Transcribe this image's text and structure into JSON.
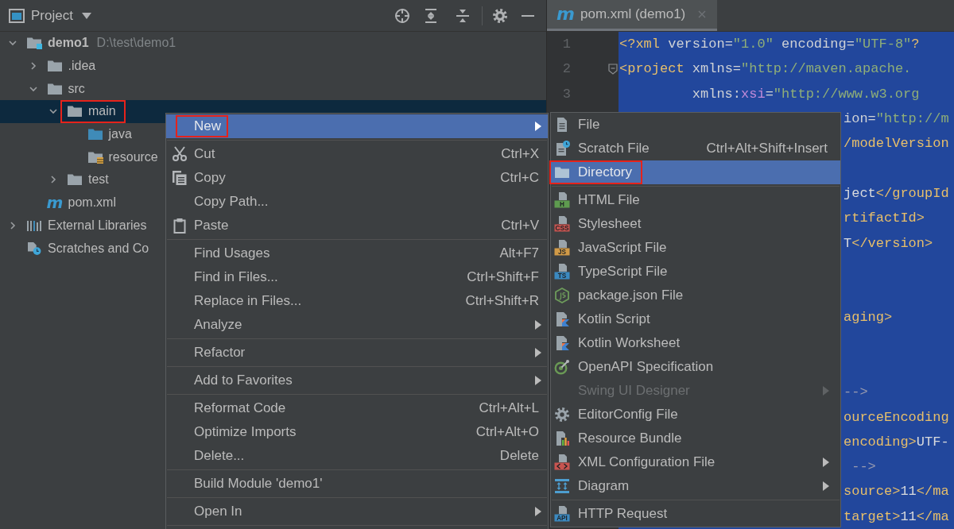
{
  "tool_window": {
    "title": "Project"
  },
  "project_tree": [
    {
      "label": "demo1",
      "path": "D:\\test\\demo1",
      "kind": "module",
      "expanded": true,
      "selected": false,
      "annotated": false,
      "children": [
        {
          "label": ".idea",
          "kind": "folder",
          "expanded": false,
          "selected": false,
          "annotated": false
        },
        {
          "label": "src",
          "kind": "folder",
          "expanded": true,
          "selected": false,
          "annotated": false,
          "children": [
            {
              "label": "main",
              "kind": "folder",
              "expanded": true,
              "selected": true,
              "annotated": true,
              "children": [
                {
                  "label": "java",
                  "kind": "source_folder",
                  "selected": false,
                  "annotated": false
                },
                {
                  "label": "resource",
                  "kind": "resources_folder",
                  "selected": false,
                  "annotated": false
                }
              ]
            },
            {
              "label": "test",
              "kind": "folder",
              "expanded": false,
              "selected": false,
              "annotated": false
            }
          ]
        },
        {
          "label": "pom.xml",
          "kind": "maven_file",
          "icon_glyph": "m",
          "selected": false,
          "annotated": false
        }
      ]
    },
    {
      "label": "External Libraries",
      "kind": "libraries",
      "expanded": false,
      "selected": false,
      "annotated": false
    },
    {
      "label": "Scratches and Co",
      "kind": "scratches",
      "selected": false,
      "annotated": false
    }
  ],
  "editor": {
    "tabs": [
      {
        "label": "pom.xml (demo1)",
        "icon_glyph": "m",
        "selected": true
      }
    ],
    "lines": [
      {
        "kind": "full",
        "number": "1",
        "fold_marker": false,
        "segments": [
          {
            "text": "<?xml",
            "kind": "tag"
          },
          {
            "text": " version",
            "kind": "attr"
          },
          {
            "text": "=",
            "kind": "attr"
          },
          {
            "text": "\"1.0\"",
            "kind": "value"
          },
          {
            "text": " encoding",
            "kind": "attr"
          },
          {
            "text": "=",
            "kind": "attr"
          },
          {
            "text": "\"UTF-8\"",
            "kind": "value"
          },
          {
            "text": "?",
            "kind": "tag"
          }
        ]
      },
      {
        "kind": "full",
        "number": "2",
        "fold_marker": true,
        "segments": [
          {
            "text": "<project",
            "kind": "tag"
          },
          {
            "text": " xmlns",
            "kind": "attr"
          },
          {
            "text": "=",
            "kind": "attr"
          },
          {
            "text": "\"http://maven.apache.",
            "kind": "value"
          }
        ]
      },
      {
        "kind": "full",
        "number": "3",
        "fold_marker": false,
        "segments": [
          {
            "text": "         xmlns:",
            "kind": "attr"
          },
          {
            "text": "xsi",
            "kind": "ns"
          },
          {
            "text": "=",
            "kind": "attr"
          },
          {
            "text": "\"http://www.w3.org",
            "kind": "value"
          }
        ]
      },
      {
        "kind": "tail",
        "segments": [
          {
            "text": "ion",
            "kind": "attr"
          },
          {
            "text": "=",
            "kind": "attr"
          },
          {
            "text": "\"http://m",
            "kind": "value"
          }
        ]
      },
      {
        "kind": "tail",
        "segments": [
          {
            "text": "/modelVersion",
            "kind": "tag"
          }
        ]
      },
      {
        "kind": "blank"
      },
      {
        "kind": "tail",
        "segments": [
          {
            "text": "ject",
            "kind": "text"
          },
          {
            "text": "</groupId",
            "kind": "tag"
          }
        ]
      },
      {
        "kind": "tail",
        "segments": [
          {
            "text": "rtifactId>",
            "kind": "tag"
          }
        ]
      },
      {
        "kind": "tail",
        "segments": [
          {
            "text": "T",
            "kind": "text"
          },
          {
            "text": "</version>",
            "kind": "tag"
          }
        ]
      },
      {
        "kind": "blank"
      },
      {
        "kind": "blank"
      },
      {
        "kind": "tail",
        "segments": [
          {
            "text": "aging>",
            "kind": "tag"
          }
        ]
      },
      {
        "kind": "blank"
      },
      {
        "kind": "blank"
      },
      {
        "kind": "tail",
        "segments": [
          {
            "text": "-->",
            "kind": "comment"
          }
        ]
      },
      {
        "kind": "tail",
        "segments": [
          {
            "text": "ourceEncoding",
            "kind": "tag"
          }
        ]
      },
      {
        "kind": "tail",
        "segments": [
          {
            "text": "encoding>",
            "kind": "tag"
          },
          {
            "text": "UTF-",
            "kind": "text"
          }
        ]
      },
      {
        "kind": "tail",
        "segments": [
          {
            "text": " -->",
            "kind": "comment"
          }
        ]
      },
      {
        "kind": "tail",
        "segments": [
          {
            "text": "source>",
            "kind": "tag"
          },
          {
            "text": "11",
            "kind": "text"
          },
          {
            "text": "</ma",
            "kind": "tag"
          }
        ]
      },
      {
        "kind": "tail",
        "segments": [
          {
            "text": "target>",
            "kind": "tag"
          },
          {
            "text": "11",
            "kind": "text"
          },
          {
            "text": "</ma",
            "kind": "tag"
          }
        ]
      }
    ]
  },
  "context_menu": {
    "items": [
      {
        "kind": "plain",
        "label": "New",
        "has_submenu": true,
        "selected": true,
        "annotated": true
      },
      {
        "kind": "separator"
      },
      {
        "kind": "cut",
        "label": "Cut",
        "shortcut": "Ctrl+X",
        "has_submenu": false,
        "selected": false,
        "annotated": false
      },
      {
        "kind": "copy",
        "label": "Copy",
        "shortcut": "Ctrl+C",
        "has_submenu": false,
        "selected": false,
        "annotated": false
      },
      {
        "kind": "plain",
        "label": "Copy Path...",
        "has_submenu": false,
        "selected": false,
        "annotated": false
      },
      {
        "kind": "paste",
        "label": "Paste",
        "shortcut": "Ctrl+V",
        "has_submenu": false,
        "selected": false,
        "annotated": false
      },
      {
        "kind": "separator"
      },
      {
        "kind": "plain",
        "label": "Find Usages",
        "shortcut": "Alt+F7",
        "has_submenu": false,
        "selected": false,
        "annotated": false
      },
      {
        "kind": "plain",
        "label": "Find in Files...",
        "shortcut": "Ctrl+Shift+F",
        "has_submenu": false,
        "selected": false,
        "annotated": false
      },
      {
        "kind": "plain",
        "label": "Replace in Files...",
        "shortcut": "Ctrl+Shift+R",
        "has_submenu": false,
        "selected": false,
        "annotated": false
      },
      {
        "kind": "plain",
        "label": "Analyze",
        "has_submenu": true,
        "selected": false,
        "annotated": false
      },
      {
        "kind": "separator"
      },
      {
        "kind": "plain",
        "label": "Refactor",
        "has_submenu": true,
        "selected": false,
        "annotated": false
      },
      {
        "kind": "separator"
      },
      {
        "kind": "plain",
        "label": "Add to Favorites",
        "has_submenu": true,
        "selected": false,
        "annotated": false
      },
      {
        "kind": "separator"
      },
      {
        "kind": "plain",
        "label": "Reformat Code",
        "shortcut": "Ctrl+Alt+L",
        "has_submenu": false,
        "selected": false,
        "annotated": false
      },
      {
        "kind": "plain",
        "label": "Optimize Imports",
        "shortcut": "Ctrl+Alt+O",
        "has_submenu": false,
        "selected": false,
        "annotated": false
      },
      {
        "kind": "plain",
        "label": "Delete...",
        "shortcut": "Delete",
        "has_submenu": false,
        "selected": false,
        "annotated": false
      },
      {
        "kind": "separator"
      },
      {
        "kind": "plain",
        "label": "Build Module 'demo1'",
        "has_submenu": false,
        "selected": false,
        "annotated": false
      },
      {
        "kind": "separator"
      },
      {
        "kind": "plain",
        "label": "Open In",
        "has_submenu": true,
        "selected": false,
        "annotated": false
      },
      {
        "kind": "separator"
      }
    ]
  },
  "new_submenu": {
    "items": [
      {
        "kind": "file",
        "label": "File",
        "has_submenu": false,
        "selected": false,
        "disabled": false,
        "annotated": false
      },
      {
        "kind": "scratch",
        "label": "Scratch File",
        "shortcut": "Ctrl+Alt+Shift+Insert",
        "has_submenu": false,
        "selected": false,
        "disabled": false,
        "annotated": false
      },
      {
        "kind": "directory",
        "label": "Directory",
        "has_submenu": false,
        "selected": true,
        "disabled": false,
        "annotated": true
      },
      {
        "kind": "separator"
      },
      {
        "kind": "html",
        "label": "HTML File",
        "icon_text": "H",
        "has_submenu": false,
        "selected": false,
        "disabled": false,
        "annotated": false
      },
      {
        "kind": "css",
        "label": "Stylesheet",
        "icon_text": "CSS",
        "has_submenu": false,
        "selected": false,
        "disabled": false,
        "annotated": false
      },
      {
        "kind": "js",
        "label": "JavaScript File",
        "icon_text": "JS",
        "has_submenu": false,
        "selected": false,
        "disabled": false,
        "annotated": false
      },
      {
        "kind": "ts",
        "label": "TypeScript File",
        "icon_text": "TS",
        "has_submenu": false,
        "selected": false,
        "disabled": false,
        "annotated": false
      },
      {
        "kind": "node",
        "label": "package.json File",
        "has_submenu": false,
        "selected": false,
        "disabled": false,
        "annotated": false
      },
      {
        "kind": "kotlin_script",
        "label": "Kotlin Script",
        "has_submenu": false,
        "selected": false,
        "disabled": false,
        "annotated": false
      },
      {
        "kind": "kotlin_worksheet",
        "label": "Kotlin Worksheet",
        "has_submenu": false,
        "selected": false,
        "disabled": false,
        "annotated": false
      },
      {
        "kind": "openapi",
        "label": "OpenAPI Specification",
        "has_submenu": false,
        "selected": false,
        "disabled": false,
        "annotated": false
      },
      {
        "kind": "plain",
        "label": "Swing UI Designer",
        "has_submenu": true,
        "selected": false,
        "disabled": true,
        "annotated": false
      },
      {
        "kind": "editorconfig",
        "label": "EditorConfig File",
        "has_submenu": false,
        "selected": false,
        "disabled": false,
        "annotated": false
      },
      {
        "kind": "bundle",
        "label": "Resource Bundle",
        "has_submenu": false,
        "selected": false,
        "disabled": false,
        "annotated": false
      },
      {
        "kind": "xml",
        "label": "XML Configuration File",
        "has_submenu": true,
        "selected": false,
        "disabled": false,
        "annotated": false
      },
      {
        "kind": "diagram",
        "label": "Diagram",
        "has_submenu": true,
        "selected": false,
        "disabled": false,
        "annotated": false
      },
      {
        "kind": "separator"
      },
      {
        "kind": "http",
        "label": "HTTP Request",
        "icon_text": "API",
        "has_submenu": false,
        "selected": false,
        "disabled": false,
        "annotated": false
      }
    ]
  }
}
